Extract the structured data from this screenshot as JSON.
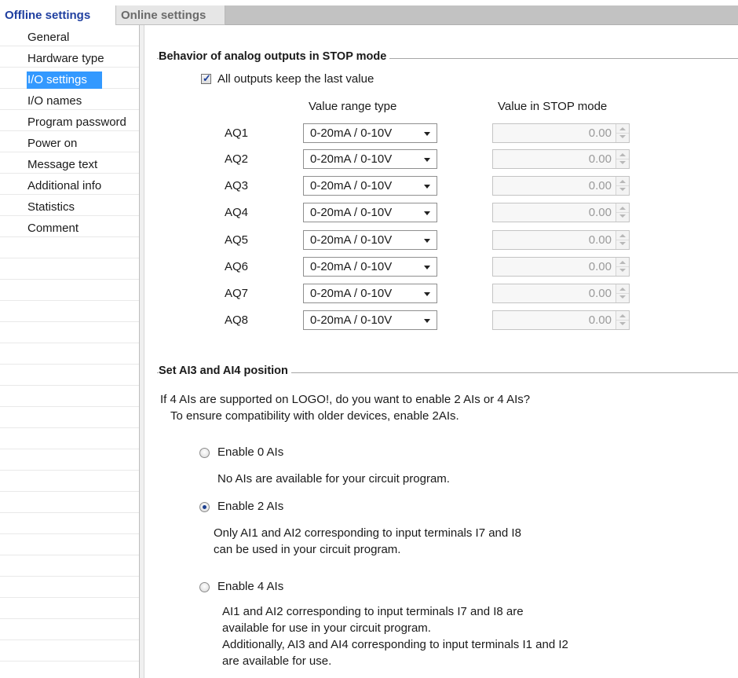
{
  "tabs": [
    {
      "label": "Offline settings",
      "active": true
    },
    {
      "label": "Online settings",
      "active": false
    }
  ],
  "sidebar": {
    "items": [
      {
        "label": "General"
      },
      {
        "label": "Hardware type"
      },
      {
        "label": "I/O settings",
        "selected": true
      },
      {
        "label": "I/O names"
      },
      {
        "label": "Program password"
      },
      {
        "label": "Power on"
      },
      {
        "label": "Message text"
      },
      {
        "label": "Additional info"
      },
      {
        "label": "Statistics"
      },
      {
        "label": "Comment"
      }
    ],
    "selected_color": "#3399ff"
  },
  "analog": {
    "title": "Behavior of analog outputs in STOP mode",
    "keep_last_label": "All outputs keep the last value",
    "keep_last_checked": true,
    "col_range": "Value range type",
    "col_value": "Value in STOP mode",
    "rows": [
      {
        "name": "AQ1",
        "range": "0-20mA / 0-10V",
        "value": "0.00"
      },
      {
        "name": "AQ2",
        "range": "0-20mA / 0-10V",
        "value": "0.00"
      },
      {
        "name": "AQ3",
        "range": "0-20mA / 0-10V",
        "value": "0.00"
      },
      {
        "name": "AQ4",
        "range": "0-20mA / 0-10V",
        "value": "0.00"
      },
      {
        "name": "AQ5",
        "range": "0-20mA / 0-10V",
        "value": "0.00"
      },
      {
        "name": "AQ6",
        "range": "0-20mA / 0-10V",
        "value": "0.00"
      },
      {
        "name": "AQ7",
        "range": "0-20mA / 0-10V",
        "value": "0.00"
      },
      {
        "name": "AQ8",
        "range": "0-20mA / 0-10V",
        "value": "0.00"
      }
    ]
  },
  "ai": {
    "title": "Set AI3 and AI4 position",
    "intro_1": "If 4 AIs are supported on LOGO!, do you want to enable 2 AIs or 4 AIs?",
    "intro_2": "To ensure compatibility with older devices, enable 2AIs.",
    "selected": "Enable 2 AIs",
    "options": [
      {
        "label": "Enable 0 AIs",
        "selected": false,
        "desc": [
          "No AIs are available for your circuit program."
        ]
      },
      {
        "label": "Enable 2 AIs",
        "selected": true,
        "desc": [
          "Only AI1 and AI2 corresponding to input terminals I7 and I8",
          "can be used in your circuit program."
        ]
      },
      {
        "label": "Enable 4 AIs",
        "selected": false,
        "desc": [
          "AI1 and AI2 corresponding to input terminals I7 and I8 are",
          "available for use in your circuit program.",
          "Additionally, AI3 and AI4 corresponding to input terminals I1 and I2",
          "are available for use."
        ]
      }
    ]
  }
}
